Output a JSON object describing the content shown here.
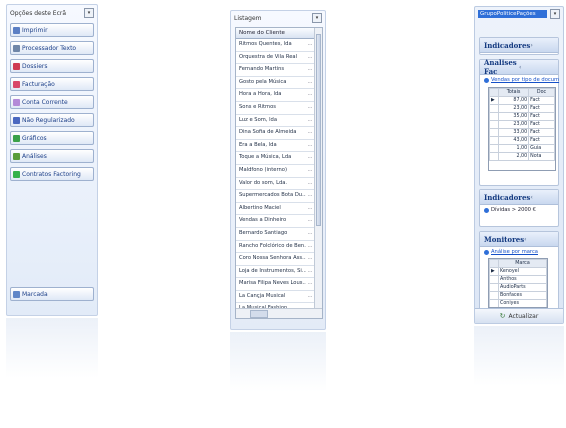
{
  "options_panel": {
    "title": "Opções deste Ecrã",
    "buttons": [
      {
        "label": "Imprimir",
        "icon": "printer-icon",
        "color": "#5b7fc4"
      },
      {
        "label": "Processador Texto",
        "icon": "text-editor-icon",
        "color": "#6f86a8"
      },
      {
        "label": "Dossiers",
        "icon": "folder-icon",
        "color": "#cf3b52"
      },
      {
        "label": "Facturação",
        "icon": "invoice-icon",
        "color": "#d8476a"
      },
      {
        "label": "Conta Corrente",
        "icon": "account-icon",
        "color": "#b48ad8"
      },
      {
        "label": "Não Regularizado",
        "icon": "person-icon",
        "color": "#4a68c0"
      },
      {
        "label": "Gráficos",
        "icon": "chart-icon",
        "color": "#3aa14a"
      },
      {
        "label": "Análises",
        "icon": "analysis-icon",
        "color": "#5a9d3a"
      },
      {
        "label": "Contratos Factoring",
        "icon": "contract-icon",
        "color": "#34b24a"
      }
    ],
    "marker_button": {
      "label": "Marcada",
      "icon": "marker-icon",
      "color": "#5f86c8"
    }
  },
  "list_panel": {
    "title": "Listagem",
    "column_header": "Nome do Cliente",
    "rows": [
      "Ritmos Quentes, lda",
      "Orquestra de Vila Real",
      "Fernando Martins",
      "Gosto pela Música",
      "Hora a Hora, lda",
      "Sons e Ritmos",
      "Luz e Som, lda",
      "Dina Sofia de Almeida",
      "Era a Bela, lda",
      "Toque a Música, Lda",
      "Maldfono (interno)",
      "Valor do som, Lda.",
      "Supermercados Bota Du...",
      "Albertino Maciel",
      "Vendas a Dinheiro",
      "Bernardo Santiago",
      "Rancho Folclórico de Ben...",
      "Coro Nossa Senhora Ass...",
      "Loja de Instrumentos, Si...",
      "Marisa Filipa Neves Lous...",
      "La Cançja Musical",
      "La Musical Fashion"
    ],
    "row_ellipsis": "..."
  },
  "side_panel": {
    "group_label": "GrupoPoliticePações",
    "sections": {
      "indicadores_top": {
        "title": "Indicadores"
      },
      "analises_fac": {
        "title": "Analises Fac",
        "link": "Vendas por tipo de docum",
        "columns": [
          "Totais",
          "Doc"
        ],
        "rows": [
          {
            "total": "87,00",
            "doc": "Fact"
          },
          {
            "total": "23,00",
            "doc": "Fact"
          },
          {
            "total": "35,00",
            "doc": "Fact"
          },
          {
            "total": "23,00",
            "doc": "Fact"
          },
          {
            "total": "33,00",
            "doc": "Fact"
          },
          {
            "total": "43,00",
            "doc": "Fact"
          },
          {
            "total": "1,00",
            "doc": "Guia"
          },
          {
            "total": "2,00",
            "doc": "Nota"
          }
        ]
      },
      "indicadores": {
        "title": "Indicadores",
        "item": "Dívidas > 2000 €"
      },
      "monitores": {
        "title": "Monitores",
        "link": "Análise por marca",
        "column": "Marca",
        "rows": [
          "Kenoyel",
          "Anthos",
          "AudioParts",
          "Bonfaces",
          "Coniyes"
        ]
      }
    },
    "refresh_label": "Actualizar",
    "accent_color": "#2f6fd8"
  }
}
